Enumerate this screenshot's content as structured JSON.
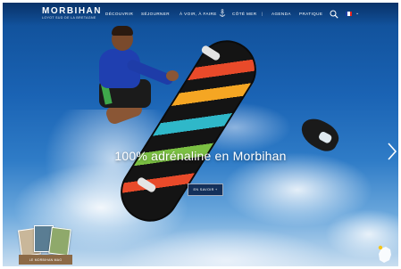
{
  "header": {
    "logo_name": "MORBIHAN",
    "logo_tagline": "LOYOT SUD DE LA BRETAGNE",
    "nav": [
      {
        "id": "decouvrir",
        "label": "DÉCOUVRIR"
      },
      {
        "id": "sejourner",
        "label": "SÉJOURNER"
      },
      {
        "id": "avoir-a-faire",
        "label": "À VOIR, À FAIRE"
      },
      {
        "id": "cote-mer",
        "label": "CÔTÉ MER"
      },
      {
        "id": "agenda",
        "label": "AGENDA"
      },
      {
        "id": "pratique",
        "label": "PRATIQUE"
      }
    ],
    "language_flag_colors": [
      "#1f3fa8",
      "#ffffff",
      "#e0231f"
    ]
  },
  "hero": {
    "title": "100% adrénaline en Morbihan",
    "cta_label": "EN SAVOIR +"
  },
  "bottom": {
    "magazine_label": "LE MORBIHAN MAG"
  },
  "colors": {
    "cta_background": "#14305a",
    "magazine_label_background": "#8c6a47",
    "map_marker": "#f5c518"
  },
  "icons": {
    "anchor": "anchor-icon",
    "search": "search-icon",
    "next": "chevron-right-icon",
    "map": "france-map-icon"
  }
}
